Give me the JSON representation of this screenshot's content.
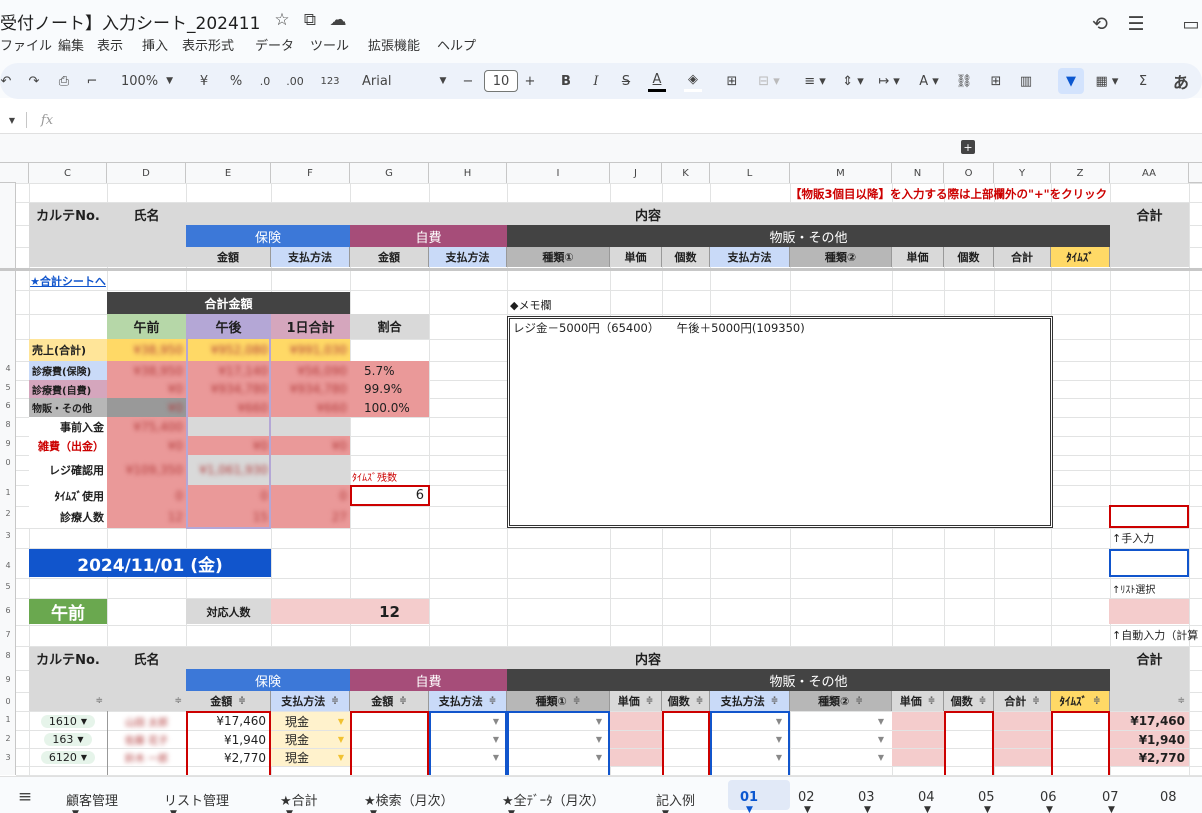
{
  "doc": {
    "title": "受付ノート】入力シート_202411",
    "star": "☆",
    "share": "⛭",
    "cloud": "☁"
  },
  "menu": [
    "ファイル",
    "編集",
    "表示",
    "挿入",
    "表示形式",
    "データ",
    "ツール",
    "拡張機能",
    "ヘルプ"
  ],
  "toolbar": {
    "zoom": "100%",
    "currency": "¥",
    "percent": "%",
    "dec_minus": ".0",
    "dec_plus": ".00",
    "fmt123": "123",
    "font": "Arial",
    "font_size": "10",
    "minus": "−",
    "plus": "+",
    "bold": "B",
    "italic": "I",
    "strike": "S",
    "underline_a": "A",
    "sigma": "Σ",
    "ja": "あ"
  },
  "formula": {
    "fx": "fx"
  },
  "columns": [
    "C",
    "D",
    "E",
    "F",
    "G",
    "H",
    "I",
    "J",
    "K",
    "L",
    "M",
    "N",
    "O",
    "Y",
    "Z",
    "AA"
  ],
  "hint": "【物販3個目以降】を入力する際は上部欄外の\"+\"をクリック",
  "header": {
    "karte": "カルテNo.",
    "name": "氏名",
    "naiyou": "内容",
    "total": "合計",
    "hoken": "保険",
    "jihi": "自費",
    "buppan": "物販・その他",
    "kingaku": "金額",
    "shiharai": "支払方法",
    "shurui1": "種類①",
    "tanka": "単価",
    "kosu": "個数",
    "shurui2": "種類②",
    "goukei": "合計",
    "timesu": "ﾀｲﾑｽﾞ"
  },
  "summary": {
    "link": "★合計シートへ",
    "title": "合計金額",
    "am": "午前",
    "pm": "午後",
    "day": "1日合計",
    "ratio": "割合",
    "rows": [
      {
        "label": "売上(合計)",
        "am": "¥38,950",
        "pm": "¥952,080",
        "day": "¥991,030",
        "ratio": ""
      },
      {
        "label": "診療費(保険)",
        "am": "¥38,950",
        "pm": "¥17,140",
        "day": "¥56,090",
        "ratio": "5.7%"
      },
      {
        "label": "診療費(自費)",
        "am": "¥0",
        "pm": "¥934,780",
        "day": "¥934,780",
        "ratio": "99.9%"
      },
      {
        "label": "物販・その他",
        "am": "¥0",
        "pm": "¥660",
        "day": "¥660",
        "ratio": "100.0%"
      },
      {
        "label": "事前入金",
        "am": "¥75,400",
        "pm": "",
        "day": "",
        "ratio": ""
      },
      {
        "label": "雑費（出金）",
        "am": "¥0",
        "pm": "¥0",
        "day": "¥0",
        "ratio": ""
      },
      {
        "label": "レジ確認用",
        "am": "¥109,350",
        "pm": "¥1,061,930",
        "day": "",
        "ratio": ""
      },
      {
        "label": "ﾀｲﾑｽﾞ使用",
        "am": "0",
        "pm": "0",
        "day": "0",
        "ratio": ""
      },
      {
        "label": "診療人数",
        "am": "12",
        "pm": "15",
        "day": "27",
        "ratio": ""
      }
    ],
    "timesu_remain_label": "ﾀｲﾑｽﾞ残数",
    "timesu_remain": "6"
  },
  "memo": {
    "label": "◆メモ欄",
    "text": "レジ金－5000円（65400）　　午後＋5000円(109350)"
  },
  "side": {
    "manual": "↑手入力",
    "list": "↑ﾘｽﾄ選択",
    "auto": "↑自動入力（計算"
  },
  "date": "2024/11/01 (金)",
  "am_section": {
    "label": "午前",
    "count_label": "対応人数",
    "count": "12"
  },
  "rows": [
    {
      "karte": "1610",
      "name": "山田 太郎",
      "amount": "¥17,460",
      "pay": "現金",
      "total": "¥17,460"
    },
    {
      "karte": "163",
      "name": "佐藤 花子",
      "amount": "¥1,940",
      "pay": "現金",
      "total": "¥1,940"
    },
    {
      "karte": "6120",
      "name": "鈴木 一郎",
      "amount": "¥2,770",
      "pay": "現金",
      "total": "¥2,770"
    }
  ],
  "tabs": [
    "顧客管理",
    "リスト管理",
    "★合計",
    "★検索（月次）",
    "★全ﾃﾞｰﾀ（月次）",
    "記入例",
    "01",
    "02",
    "03",
    "04",
    "05",
    "06",
    "07",
    "08"
  ],
  "colors": {
    "blue": "#3c78d8",
    "magenta": "#a64d79",
    "dark": "#434343",
    "pink": "#f4cccc",
    "green": "#6aa84f",
    "date_blue": "#1155cc",
    "yellow": "#ffd966",
    "lightblue": "#c9daf8",
    "red": "#cc0000"
  }
}
